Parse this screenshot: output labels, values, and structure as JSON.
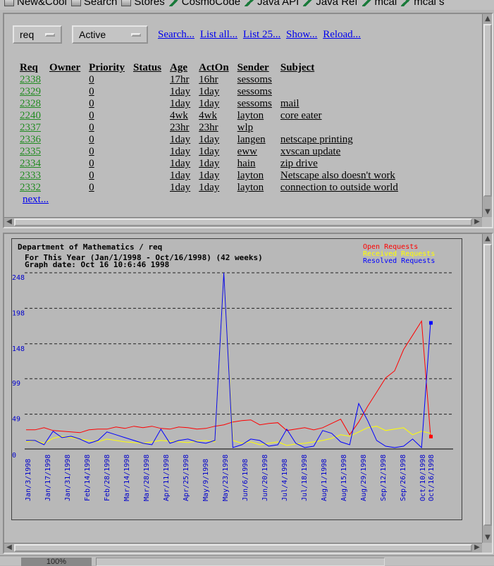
{
  "toolbar": {
    "items": [
      {
        "label": "New&Cool",
        "icon": "folder-icon"
      },
      {
        "label": "Search",
        "icon": "folder-icon"
      },
      {
        "label": "Stores",
        "icon": "folder-icon"
      },
      {
        "label": "CosmoCode",
        "icon": "pen-icon"
      },
      {
        "label": "Java API",
        "icon": "pen-icon"
      },
      {
        "label": "Java Ref",
        "icon": "pen-icon"
      },
      {
        "label": "mcal",
        "icon": "pen-icon"
      },
      {
        "label": "mcal s",
        "icon": "pen-icon"
      }
    ]
  },
  "controls": {
    "queue_select": "req",
    "state_select": "Active",
    "links": [
      "Search...",
      "List all...",
      "List 25...",
      "Show...",
      "Reload..."
    ]
  },
  "table": {
    "headers": [
      "Req",
      "Owner",
      "Priority",
      "Status",
      "Age",
      "ActOn",
      "Sender",
      "Subject"
    ],
    "rows": [
      [
        "2338",
        "",
        "0",
        "",
        "17hr",
        "16hr",
        "sessoms",
        ""
      ],
      [
        "2329",
        "",
        "0",
        "",
        "1day",
        "1day",
        "sessoms",
        ""
      ],
      [
        "2328",
        "",
        "0",
        "",
        "1day",
        "1day",
        "sessoms",
        "mail"
      ],
      [
        "2240",
        "",
        "0",
        "",
        "4wk",
        "4wk",
        "layton",
        "core eater"
      ],
      [
        "2337",
        "",
        "0",
        "",
        "23hr",
        "23hr",
        "wlp",
        ""
      ],
      [
        "2336",
        "",
        "0",
        "",
        "1day",
        "1day",
        "langen",
        "netscape printing"
      ],
      [
        "2335",
        "",
        "0",
        "",
        "1day",
        "1day",
        "eww",
        "xvscan update"
      ],
      [
        "2334",
        "",
        "0",
        "",
        "1day",
        "1day",
        "hain",
        "zip drive"
      ],
      [
        "2333",
        "",
        "0",
        "",
        "1day",
        "1day",
        "layton",
        "Netscape also doesn't work"
      ],
      [
        "2332",
        "",
        "0",
        "",
        "1day",
        "1day",
        "layton",
        "connection to outside world"
      ]
    ],
    "next_link": "next..."
  },
  "status": {
    "zoom": "100%"
  },
  "colors": {
    "open": "#ff0000",
    "received": "#ffff00",
    "resolved": "#0000ff",
    "link": "#0000ee",
    "req_link": "#228b22"
  },
  "chart_data": {
    "type": "line",
    "title": "Department of Mathematics / req",
    "subtitle": "For This Year (Jan/1/1998 - Oct/16/1998) (42 weeks)",
    "graph_date": "Graph date: Oct 16 10:6:46 1998",
    "legend": [
      "Open Requests",
      "Received Requests",
      "Resolved Requests"
    ],
    "legend_position": "top-right",
    "y_ticks": [
      "0",
      "49",
      "99",
      "148",
      "198",
      "248"
    ],
    "y_tick_values": [
      0,
      49,
      99,
      148,
      198,
      248
    ],
    "ylim": [
      0,
      248
    ],
    "grid": true,
    "x_tick_labels": [
      "Jan/3/1998",
      "Jan/17/1998",
      "Jan/31/1998",
      "Feb/14/1998",
      "Feb/28/1998",
      "Mar/14/1998",
      "Mar/28/1998",
      "Apr/11/1998",
      "Apr/25/1998",
      "May/9/1998",
      "May/23/1998",
      "Jun/6/1998",
      "Jun/20/1998",
      "Jul/4/1998",
      "Jul/18/1998",
      "Aug/1/1998",
      "Aug/15/1998",
      "Aug/29/1998",
      "Sep/12/1998",
      "Sep/26/1998",
      "Oct/10/1998",
      "Oct/16/1998"
    ],
    "series": [
      {
        "name": "Open Requests",
        "color": "#ff0000",
        "values": [
          27,
          27,
          30,
          26,
          25,
          24,
          23,
          27,
          28,
          28,
          31,
          29,
          32,
          30,
          32,
          29,
          28,
          31,
          30,
          28,
          29,
          32,
          34,
          38,
          40,
          41,
          34,
          36,
          37,
          26,
          28,
          30,
          27,
          30,
          36,
          42,
          20,
          38,
          60,
          80,
          100,
          110,
          140,
          160,
          180,
          18
        ]
      },
      {
        "name": "Received Requests",
        "color": "#ffff00",
        "values": [
          10,
          12,
          8,
          15,
          18,
          16,
          14,
          12,
          10,
          14,
          12,
          10,
          9,
          8,
          10,
          12,
          11,
          10,
          9,
          11,
          12,
          10,
          248,
          12,
          8,
          10,
          6,
          8,
          10,
          5,
          7,
          8,
          10,
          12,
          15,
          20,
          18,
          24,
          30,
          32,
          26,
          28,
          30,
          20,
          25,
          22
        ]
      },
      {
        "name": "Resolved Requests",
        "color": "#0000ff",
        "values": [
          12,
          12,
          6,
          25,
          16,
          18,
          14,
          8,
          12,
          24,
          20,
          16,
          12,
          8,
          6,
          28,
          8,
          12,
          14,
          10,
          8,
          12,
          248,
          2,
          6,
          14,
          12,
          4,
          6,
          28,
          8,
          2,
          4,
          26,
          22,
          10,
          6,
          64,
          40,
          12,
          4,
          2,
          4,
          14,
          2,
          178
        ]
      }
    ]
  }
}
